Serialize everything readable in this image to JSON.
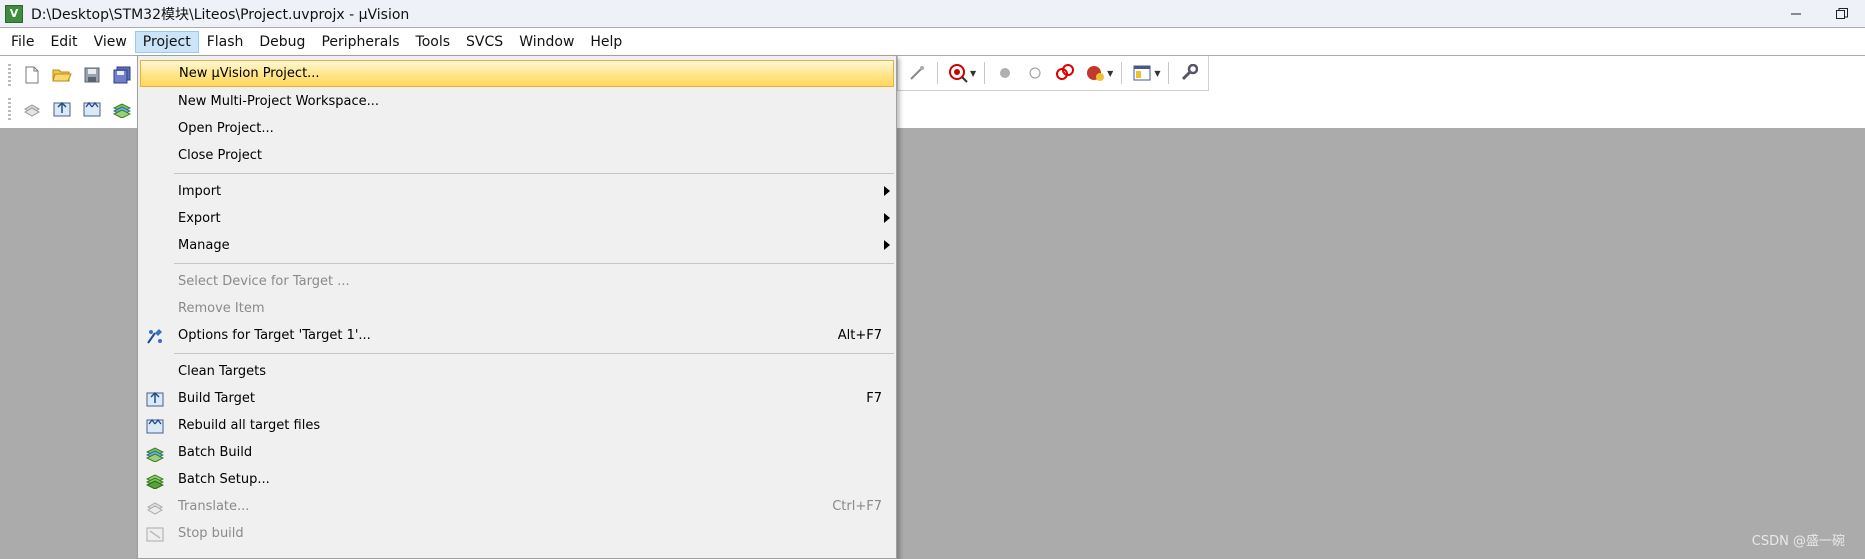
{
  "window": {
    "title": "D:\\Desktop\\STM32模块\\Liteos\\Project.uvprojx - µVision",
    "app_icon_letter": "V"
  },
  "menubar": {
    "items": [
      {
        "label": "File"
      },
      {
        "label": "Edit"
      },
      {
        "label": "View"
      },
      {
        "label": "Project",
        "active": true
      },
      {
        "label": "Flash"
      },
      {
        "label": "Debug"
      },
      {
        "label": "Peripherals"
      },
      {
        "label": "Tools"
      },
      {
        "label": "SVCS"
      },
      {
        "label": "Window"
      },
      {
        "label": "Help"
      }
    ]
  },
  "project_menu": {
    "items": {
      "new_project": {
        "label": "New µVision Project..."
      },
      "new_multi": {
        "label": "New Multi-Project Workspace..."
      },
      "open_project": {
        "label": "Open Project..."
      },
      "close_project": {
        "label": "Close Project"
      },
      "import": {
        "label": "Import"
      },
      "export": {
        "label": "Export"
      },
      "manage": {
        "label": "Manage"
      },
      "select_device": {
        "label": "Select Device for Target ..."
      },
      "remove_item": {
        "label": "Remove Item"
      },
      "options_target": {
        "label": "Options for Target 'Target 1'...",
        "shortcut": "Alt+F7"
      },
      "clean_targets": {
        "label": "Clean Targets"
      },
      "build_target": {
        "label": "Build Target",
        "shortcut": "F7"
      },
      "rebuild_all": {
        "label": "Rebuild all target files"
      },
      "batch_build": {
        "label": "Batch Build"
      },
      "batch_setup": {
        "label": "Batch Setup..."
      },
      "translate": {
        "label": "Translate...",
        "shortcut": "Ctrl+F7"
      },
      "stop_build": {
        "label": "Stop build"
      }
    }
  },
  "colors": {
    "workspace_bg": "#ababab",
    "menu_highlight": "#ffd75a",
    "menubar_active": "#cce4f7"
  },
  "watermark": "CSDN @盛一碗"
}
